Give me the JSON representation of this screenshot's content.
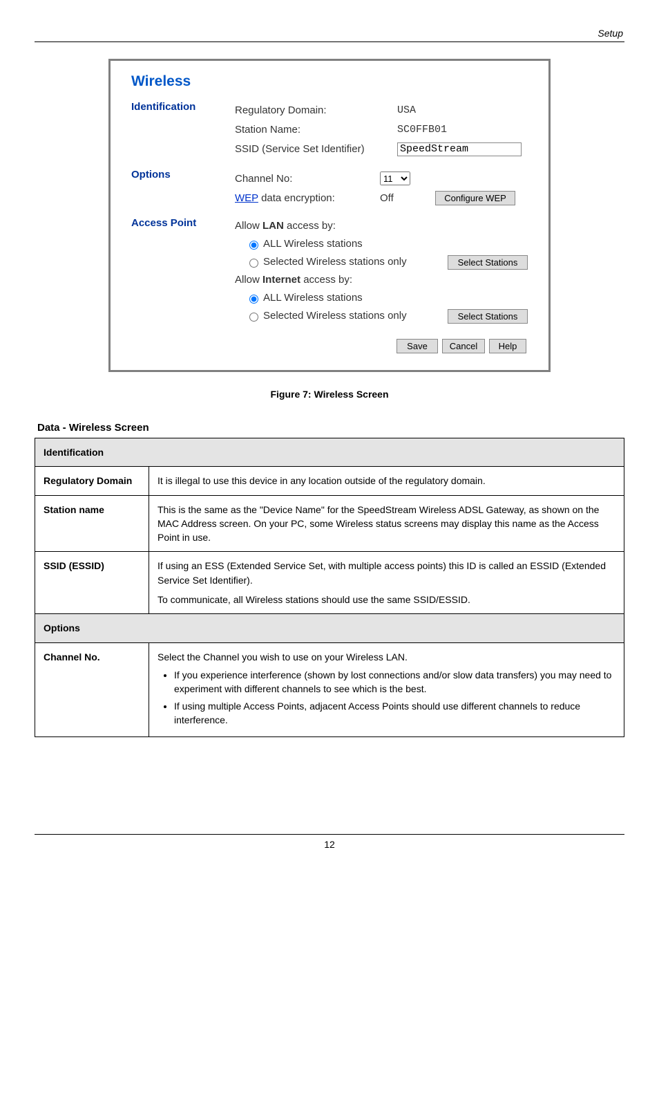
{
  "header": {
    "right_text": "Setup"
  },
  "panel": {
    "title": "Wireless",
    "identification": {
      "heading": "Identification",
      "reg_label": "Regulatory Domain:",
      "reg_value": "USA",
      "station_label": "Station Name:",
      "station_value": "SC0FFB01",
      "ssid_label": "SSID (Service Set Identifier)",
      "ssid_value": "SpeedStream"
    },
    "options": {
      "heading": "Options",
      "channel_label": "Channel No:",
      "channel_value": "11",
      "wep_label_pre": "WEP",
      "wep_label_post": " data encryption:",
      "wep_value": "Off",
      "wep_btn": "Configure WEP"
    },
    "ap": {
      "heading": "Access Point",
      "lan_label_pre": "Allow ",
      "lan_label_bold": "LAN",
      "lan_label_post": " access by:",
      "opt_all": "ALL Wireless stations",
      "opt_sel": "Selected Wireless stations only",
      "select_btn": "Select Stations",
      "int_label_pre": "Allow ",
      "int_label_bold": "Internet",
      "int_label_post": " access by:"
    },
    "buttons": {
      "save": "Save",
      "cancel": "Cancel",
      "help": "Help"
    }
  },
  "caption": "Figure 7: Wireless Screen",
  "data_heading": "Data - Wireless Screen",
  "table": {
    "sec1": "Identification",
    "row_reg_k": "Regulatory Domain",
    "row_reg_v": "It is illegal to use this device in any location outside of the regulatory domain.",
    "row_station_k": "Station name",
    "row_station_v": "This is the same as the \"Device Name\" for the SpeedStream Wireless ADSL Gateway, as shown on the MAC Address screen. On your PC, some Wireless status screens may display this name as the Access Point in use.",
    "row_ssid_k": "SSID (ESSID)",
    "row_ssid_v_main": "If using an ESS (Extended Service Set, with multiple access points) this ID is called an ESSID (Extended Service Set Identifier).",
    "row_ssid_v_lead": "To communicate, all Wireless stations should use the same SSID/ESSID.",
    "sec2": "Options",
    "row_chan_k": "Channel No.",
    "row_chan_v1": "Select the Channel you wish to use on your Wireless LAN.",
    "row_chan_v2": "If you experience interference (shown by lost connections and/or slow data transfers) you may need to experiment with different channels to see which is the best.",
    "row_chan_v3": "If using multiple Access Points, adjacent Access Points should use different channels to reduce interference."
  },
  "footer": {
    "page": "12"
  }
}
